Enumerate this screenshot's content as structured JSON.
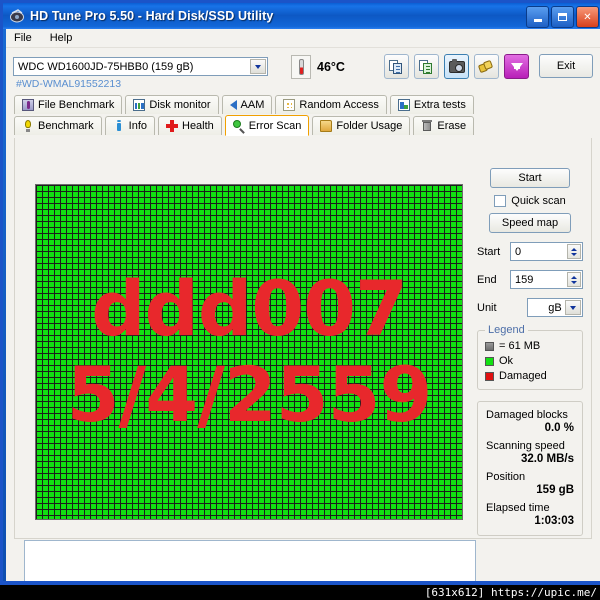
{
  "window": {
    "title": "HD Tune Pro 5.50 - Hard Disk/SSD Utility",
    "title_icon": "hdtune-disk-icon",
    "minimize_label": "Minimize",
    "maximize_label": "Maximize",
    "close_label": "Close"
  },
  "menu": {
    "items": [
      {
        "label": "File"
      },
      {
        "label": "Help"
      }
    ]
  },
  "toolbar": {
    "drive": {
      "value": "WDC WD1600JD-75HBB0 (159 gB)",
      "serial": "#WD-WMAL91552213"
    },
    "temperature": "46°C",
    "thermometer_icon": "thermometer-icon",
    "buttons": [
      {
        "name": "copy-icon",
        "label": "Copy"
      },
      {
        "name": "copy-green-icon",
        "label": "Copy to clipboard"
      },
      {
        "name": "camera-icon",
        "label": "Screenshot"
      },
      {
        "name": "key-icon",
        "label": "Key"
      },
      {
        "name": "download-icon",
        "label": "Save"
      }
    ],
    "exit_label": "Exit"
  },
  "tabs": {
    "row1": [
      {
        "label": "File Benchmark",
        "icon": "file-benchmark-icon",
        "active": false
      },
      {
        "label": "Disk monitor",
        "icon": "disk-monitor-icon",
        "active": false
      },
      {
        "label": "AAM",
        "icon": "aam-speaker-icon",
        "active": false
      },
      {
        "label": "Random Access",
        "icon": "random-access-icon",
        "active": false
      },
      {
        "label": "Extra tests",
        "icon": "extra-tests-icon",
        "active": false
      }
    ],
    "row2": [
      {
        "label": "Benchmark",
        "icon": "benchmark-bulb-icon",
        "active": false
      },
      {
        "label": "Info",
        "icon": "info-icon",
        "active": false
      },
      {
        "label": "Health",
        "icon": "health-cross-icon",
        "active": false
      },
      {
        "label": "Error Scan",
        "icon": "error-scan-magnifier-icon",
        "active": true
      },
      {
        "label": "Folder Usage",
        "icon": "folder-usage-icon",
        "active": false
      },
      {
        "label": "Erase",
        "icon": "erase-trash-icon",
        "active": false
      }
    ]
  },
  "error_scan": {
    "overlay_text_line1": "ddd007",
    "overlay_text_line2": "5/4/2559",
    "overlay_color": "#e8282c",
    "block_ok_color": "#12e012",
    "block_damaged_color": "#e01010",
    "start_button": "Start",
    "quick_scan_label": "Quick scan",
    "quick_scan_checked": false,
    "speed_map_button": "Speed map",
    "fields": [
      {
        "label": "Start",
        "value": "0"
      },
      {
        "label": "End",
        "value": "159"
      }
    ],
    "unit": {
      "label": "Unit",
      "value": "gB"
    },
    "legend": {
      "title": "Legend",
      "entries": [
        {
          "label": "= 61 MB",
          "color": "#7e7e7e"
        },
        {
          "label": "Ok",
          "color": "#12e012"
        },
        {
          "label": "Damaged",
          "color": "#e01010"
        }
      ]
    },
    "stats": [
      {
        "label": "Damaged blocks",
        "value": "0.0 %"
      },
      {
        "label": "Scanning speed",
        "value": "32.0 MB/s"
      },
      {
        "label": "Position",
        "value": "159 gB"
      },
      {
        "label": "Elapsed time",
        "value": "1:03:03"
      }
    ],
    "log_text": ""
  },
  "watermark": {
    "text": "[631x612] https://upic.me/"
  }
}
